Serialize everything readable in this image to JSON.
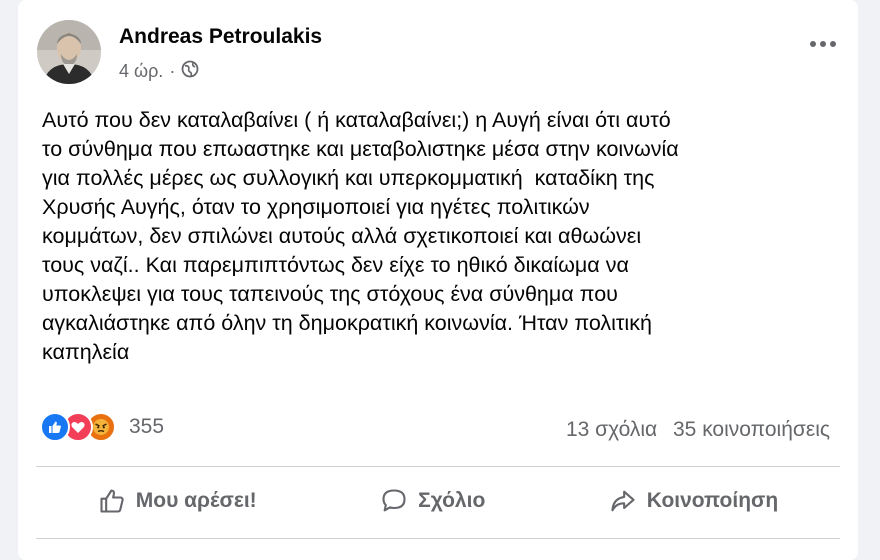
{
  "post": {
    "author": "Andreas Petroulakis",
    "time": "4 ώρ.",
    "separator": "·",
    "audience_icon": "globe-icon",
    "text": "Αυτό που δεν καταλαβαίνει ( ή καταλαβαίνει;) η Αυγή είναι ότι αυτό\nτο σύνθημα που επωαστηκε και μεταβολιστηκε μέσα στην κοινωνία\nγια πολλές μέρες ως συλλογική και υπερκομματική  καταδίκη της\nΧρυσής Αυγής, όταν το χρησιμοποιεί για ηγέτες πολιτικών\nκομμάτων, δεν σπιλώνει αυτούς αλλά σχετικοποιεί και αθωώνει\nτους ναζί.. Και παρεμπιπτόντως δεν είχε το ηθικό δικαίωμα να\nυποκλεψει για τους ταπεινούς της στόχους ένα σύνθημα που\nαγκαλιάστηκε από όλην τη δημοκρατική κοινωνία. Ήταν πολιτική\nκαπηλεία"
  },
  "reactions": {
    "icons": [
      "like-icon",
      "love-icon",
      "angry-icon"
    ],
    "count": "355"
  },
  "stats": {
    "comments": "13 σχόλια",
    "shares": "35 κοινοποιήσεις"
  },
  "actions": {
    "like": "Μου αρέσει!",
    "comment": "Σχόλιο",
    "share": "Κοινοποίηση"
  },
  "colors": {
    "like_blue": "#1877f2",
    "love_red": "#f33e58",
    "angry_orange": "#e9710f",
    "secondary_text": "#65676b"
  }
}
